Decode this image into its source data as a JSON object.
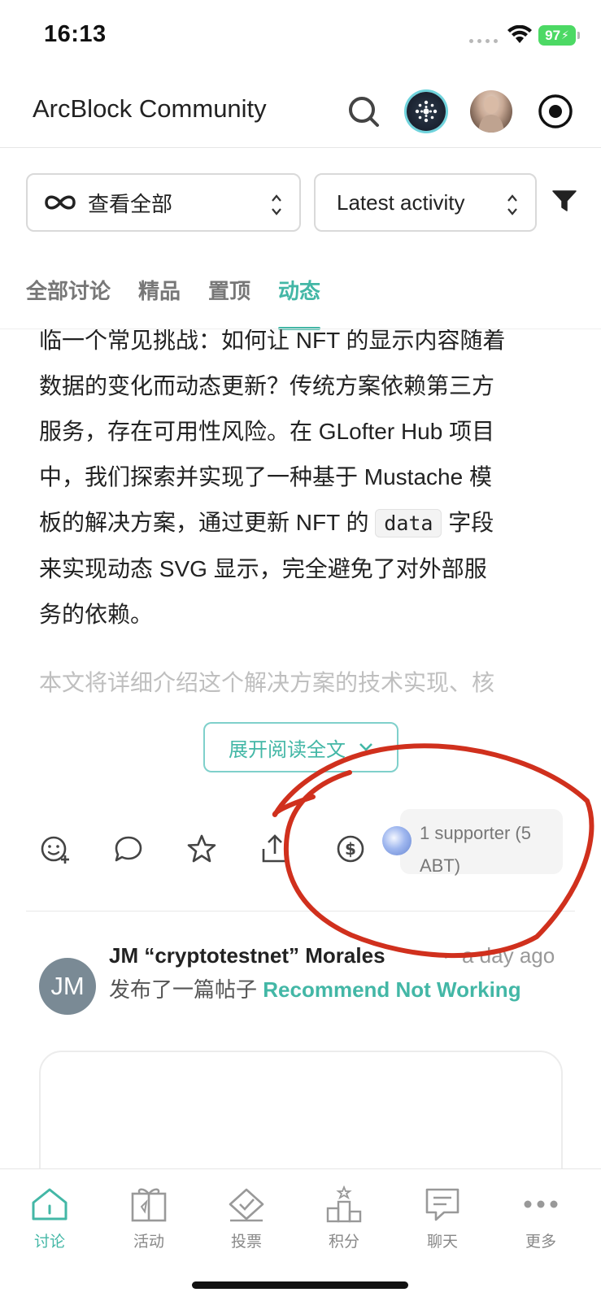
{
  "status_bar": {
    "time": "16:13",
    "battery": "97"
  },
  "header": {
    "title": "ArcBlock Community"
  },
  "filters": {
    "scope": "查看全部",
    "sort": "Latest activity"
  },
  "tabs": [
    {
      "label": "全部讨论",
      "active": false
    },
    {
      "label": "精品",
      "active": false
    },
    {
      "label": "置顶",
      "active": false
    },
    {
      "label": "动态",
      "active": true
    }
  ],
  "article": {
    "line1": "临一个常见挑战：如何让 NFT 的显示内容随着",
    "line2": "数据的变化而动态更新？传统方案依赖第三方",
    "line3": "服务，存在可用性风险。在 GLofter Hub 项目",
    "line4": "中，我们探索并实现了一种基于 Mustache 模",
    "line5_before": "板的解决方案，通过更新 NFT 的 ",
    "line5_code": "data",
    "line5_after": " 字段",
    "line6": "来实现动态 SVG 显示，完全避免了对外部服",
    "line7": "务的依赖。",
    "next_paragraph": "本文将详细介绍这个解决方案的技术实现、核",
    "expand_label": "展开阅读全文"
  },
  "support": {
    "text": "1 supporter (5 ABT)"
  },
  "post": {
    "avatar_initials": "JM",
    "author": "JM “cryptotestnet” Morales",
    "separator": "·",
    "time": "a day ago",
    "action": "发布了一篇帖子",
    "title": "Recommend Not Working"
  },
  "bottom_nav": [
    {
      "label": "讨论",
      "icon": "home-icon",
      "active": true
    },
    {
      "label": "活动",
      "icon": "gift-icon",
      "active": false
    },
    {
      "label": "投票",
      "icon": "vote-icon",
      "active": false
    },
    {
      "label": "积分",
      "icon": "podium-icon",
      "active": false
    },
    {
      "label": "聊天",
      "icon": "chat-icon",
      "active": false
    },
    {
      "label": "更多",
      "icon": "more-icon",
      "active": false
    }
  ],
  "colors": {
    "accent": "#43b7a6",
    "annotation": "#d0301d"
  }
}
